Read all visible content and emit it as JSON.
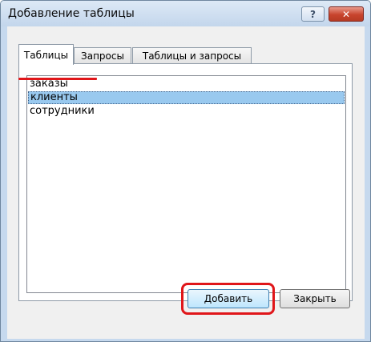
{
  "window": {
    "title": "Добавление таблицы",
    "help_button": "?",
    "close_button": "✕"
  },
  "tabs": [
    {
      "label": "Таблицы",
      "active": true
    },
    {
      "label": "Запросы",
      "active": false
    },
    {
      "label": "Таблицы и запросы",
      "active": false
    }
  ],
  "list": {
    "items": [
      {
        "label": "заказы",
        "selected": false
      },
      {
        "label": "клиенты",
        "selected": true
      },
      {
        "label": "сотрудники",
        "selected": false
      }
    ]
  },
  "buttons": {
    "add_label": "Добавить",
    "close_label": "Закрыть"
  },
  "colors": {
    "selection": "#99c9ef",
    "annotation_red": "#e0161a",
    "frame": "#c6d9ee"
  }
}
